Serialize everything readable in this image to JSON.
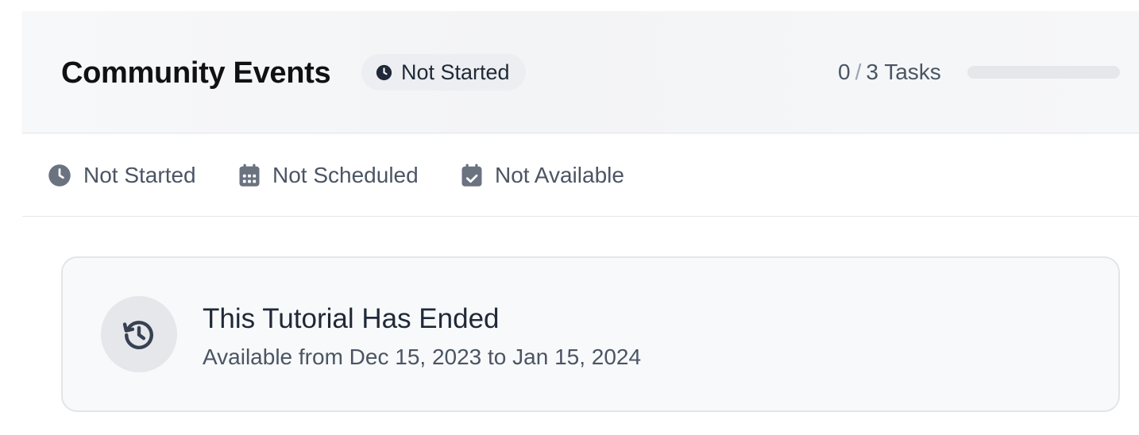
{
  "header": {
    "title": "Community Events",
    "status_label": "Not Started",
    "tasks_done": "0",
    "tasks_separator": "/",
    "tasks_total_label": "3 Tasks",
    "progress_fraction": 0
  },
  "meta": {
    "items": [
      {
        "icon": "clock-icon",
        "label": "Not Started"
      },
      {
        "icon": "calendar-icon",
        "label": "Not Scheduled"
      },
      {
        "icon": "calendar-check-icon",
        "label": "Not Available"
      }
    ]
  },
  "notice": {
    "icon": "history-icon",
    "title": "This Tutorial Has Ended",
    "subtitle": "Available from Dec 15, 2023 to Jan 15, 2024"
  },
  "colors": {
    "icon_gray": "#6b7280",
    "icon_dark": "#1f2937",
    "track": "#e5e7eb"
  }
}
